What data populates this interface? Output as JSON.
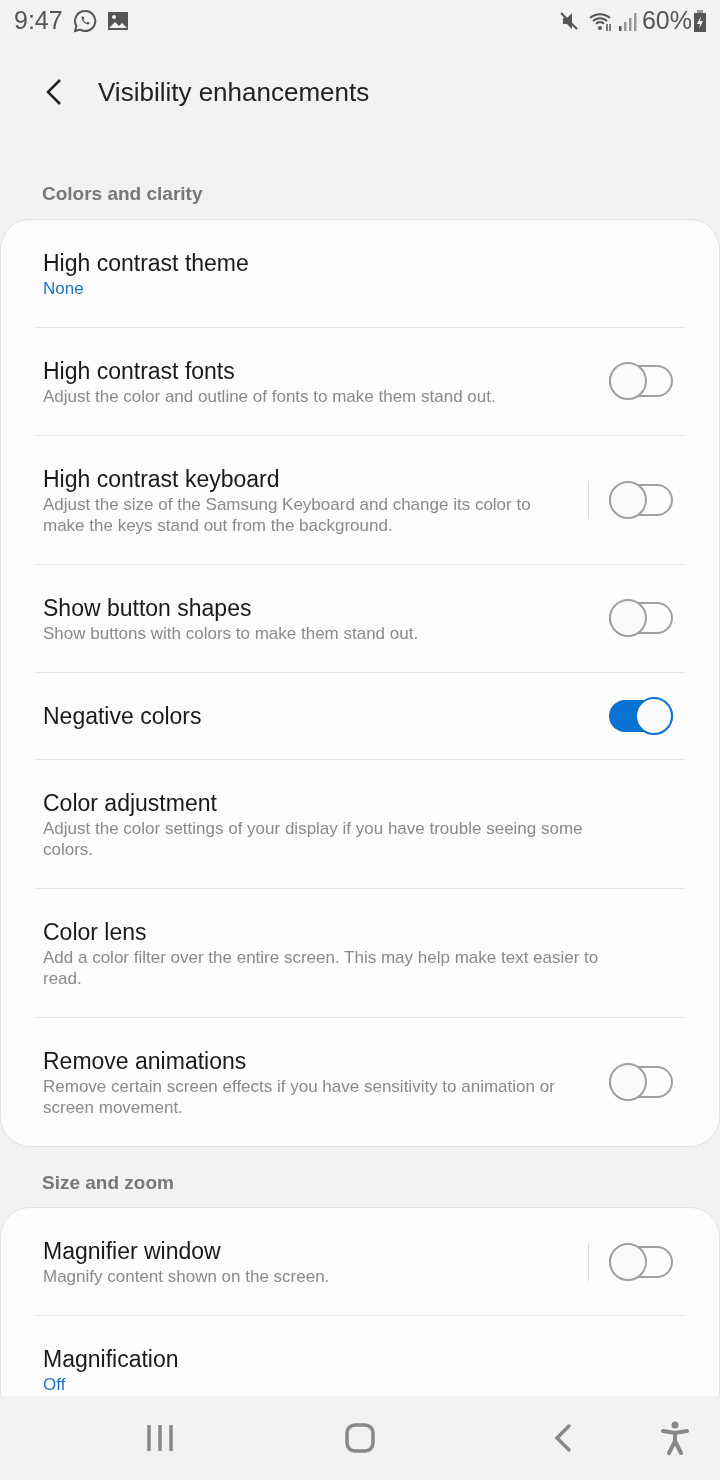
{
  "status_bar": {
    "time": "9:47",
    "battery": "60%"
  },
  "header": {
    "title": "Visibility enhancements"
  },
  "sections": [
    {
      "title": "Colors and clarity",
      "items": [
        {
          "title": "High contrast theme",
          "summary": "None"
        },
        {
          "title": "High contrast fonts",
          "description": "Adjust the color and outline of fonts to make them stand out.",
          "switch": {
            "on": false,
            "separator": false
          }
        },
        {
          "title": "High contrast keyboard",
          "description": "Adjust the size of the Samsung Keyboard and change its color to make the keys stand out from the background.",
          "switch": {
            "on": false,
            "separator": true
          }
        },
        {
          "title": "Show button shapes",
          "description": "Show buttons with colors to make them stand out.",
          "switch": {
            "on": false,
            "separator": false
          }
        },
        {
          "title": "Negative colors",
          "switch": {
            "on": true,
            "separator": false
          }
        },
        {
          "title": "Color adjustment",
          "description": "Adjust the color settings of your display if you have trouble seeing some colors."
        },
        {
          "title": "Color lens",
          "description": "Add a color filter over the entire screen. This may help make text easier to read."
        },
        {
          "title": "Remove animations",
          "description": "Remove certain screen effects if you have sensitivity to animation or screen movement.",
          "switch": {
            "on": false,
            "separator": false
          }
        }
      ]
    },
    {
      "title": "Size and zoom",
      "items": [
        {
          "title": "Magnifier window",
          "description": "Magnify content shown on the screen.",
          "switch": {
            "on": false,
            "separator": true
          }
        },
        {
          "title": "Magnification",
          "summary": "Off"
        }
      ]
    }
  ]
}
